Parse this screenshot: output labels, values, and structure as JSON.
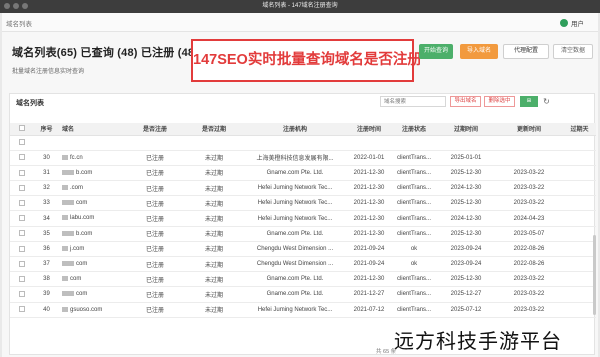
{
  "window": {
    "title": "域名列表 - 147域名注册查询"
  },
  "header": {
    "brand": "域名列表",
    "user_label": "用户"
  },
  "page": {
    "title": "域名列表(65) 已查询 (48) 已注册 (48)",
    "subtitle": "批量域名注册信息实时查询",
    "banner": "147SEO实时批量查询域名是否注册"
  },
  "actions": {
    "start_query": "开始查询",
    "import_domains": "导入域名",
    "proxy_config": "代理配置",
    "clear_data": "清空数据"
  },
  "panel": {
    "title": "域名列表",
    "search_placeholder": "域名搜索",
    "export_domains": "导出域名",
    "delete_selected": "删除选中",
    "green_btn": "⊞"
  },
  "table": {
    "columns": [
      "",
      "序号",
      "域名",
      "是否注册",
      "是否过期",
      "注册机构",
      "注册时间",
      "注册状态",
      "过期时间",
      "更新时间",
      "过期天"
    ],
    "rows": [
      [
        "",
        "",
        "",
        "",
        "",
        "",
        "",
        "",
        "",
        "",
        ""
      ],
      [
        "",
        "30",
        "fc.cn",
        "已注册",
        "未过期",
        "上海美橙科技信息发展有限...",
        "2022-01-01",
        "clientTrans...",
        "2025-01-01",
        "",
        ""
      ],
      [
        "",
        "31",
        "b.com",
        "已注册",
        "未过期",
        "Gname.com Pte. Ltd.",
        "2021-12-30",
        "clientTrans...",
        "2025-12-30",
        "2023-03-22",
        ""
      ],
      [
        "",
        "32",
        ".com",
        "已注册",
        "未过期",
        "Hefei Juming Network Tec...",
        "2021-12-30",
        "clientTrans...",
        "2024-12-30",
        "2023-03-22",
        ""
      ],
      [
        "",
        "33",
        "com",
        "已注册",
        "未过期",
        "Hefei Juming Network Tec...",
        "2021-12-30",
        "clientTrans...",
        "2025-12-30",
        "2023-03-22",
        ""
      ],
      [
        "",
        "34",
        "labu.com",
        "已注册",
        "未过期",
        "Hefei Juming Network Tec...",
        "2021-12-30",
        "clientTrans...",
        "2024-12-30",
        "2024-04-23",
        ""
      ],
      [
        "",
        "35",
        "b.com",
        "已注册",
        "未过期",
        "Gname.com Pte. Ltd.",
        "2021-12-30",
        "clientTrans...",
        "2025-12-30",
        "2023-05-07",
        ""
      ],
      [
        "",
        "36",
        "j.com",
        "已注册",
        "未过期",
        "Chengdu West Dimension ...",
        "2021-09-24",
        "ok",
        "2023-09-24",
        "2022-08-26",
        ""
      ],
      [
        "",
        "37",
        "com",
        "已注册",
        "未过期",
        "Chengdu West Dimension ...",
        "2021-09-24",
        "ok",
        "2023-09-24",
        "2022-08-26",
        ""
      ],
      [
        "",
        "38",
        "com",
        "已注册",
        "未过期",
        "Gname.com Pte. Ltd.",
        "2021-12-30",
        "clientTrans...",
        "2025-12-30",
        "2023-03-22",
        ""
      ],
      [
        "",
        "39",
        "com",
        "已注册",
        "未过期",
        "Gname.com Pte. Ltd.",
        "2021-12-27",
        "clientTrans...",
        "2025-12-27",
        "2023-03-22",
        ""
      ],
      [
        "",
        "40",
        "gsuoso.com",
        "已注册",
        "未过期",
        "Hefei Juming Network Tec...",
        "2021-07-12",
        "clientTrans...",
        "2025-07-12",
        "2023-03-22",
        ""
      ]
    ]
  },
  "footer": {
    "pager": "共 65 条"
  },
  "watermark": "远方科技手游平台"
}
